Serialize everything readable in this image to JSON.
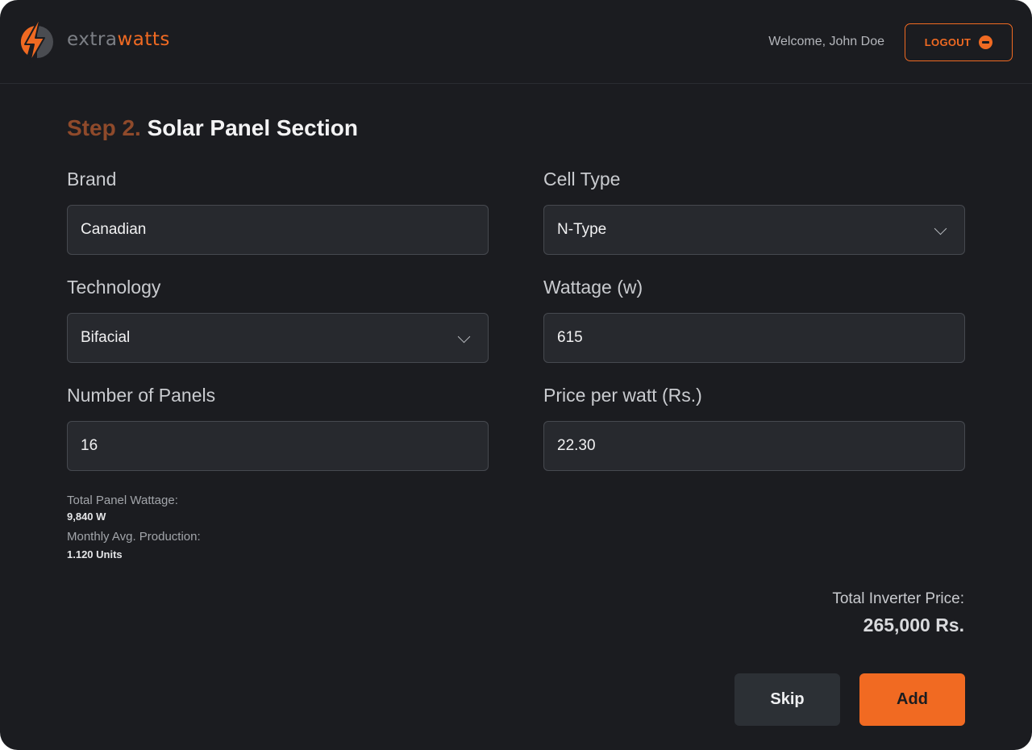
{
  "brand": {
    "name_part1": "extra",
    "name_part2": "watts",
    "accent": "#f06a22",
    "icon": "lightning-bolt-icon"
  },
  "header": {
    "welcome": "Welcome, John Doe",
    "logout_label": "LOGOUT",
    "logout_icon": "logout-circle-icon"
  },
  "page": {
    "step": "Step 2.",
    "title": "Solar Panel Section"
  },
  "form": {
    "brand": {
      "label": "Brand",
      "value": "Canadian"
    },
    "cell_type": {
      "label": "Cell Type",
      "value": "N-Type"
    },
    "technology": {
      "label": "Technology",
      "value": "Bifacial"
    },
    "wattage": {
      "label": "Wattage (w)",
      "value": "615"
    },
    "panels": {
      "label": "Number of Panels",
      "value": "16"
    },
    "price": {
      "label": "Price per watt (Rs.)",
      "value": "22.30"
    }
  },
  "summary": {
    "total_wattage_label": "Total Panel Wattage:",
    "total_wattage_value": "9,840 W",
    "monthly_label": "Monthly Avg. Production:",
    "monthly_value": "1.120 Units"
  },
  "total": {
    "label": "Total Inverter Price:",
    "value": "265,000 Rs."
  },
  "actions": {
    "skip_label": "Skip",
    "add_label": "Add"
  }
}
